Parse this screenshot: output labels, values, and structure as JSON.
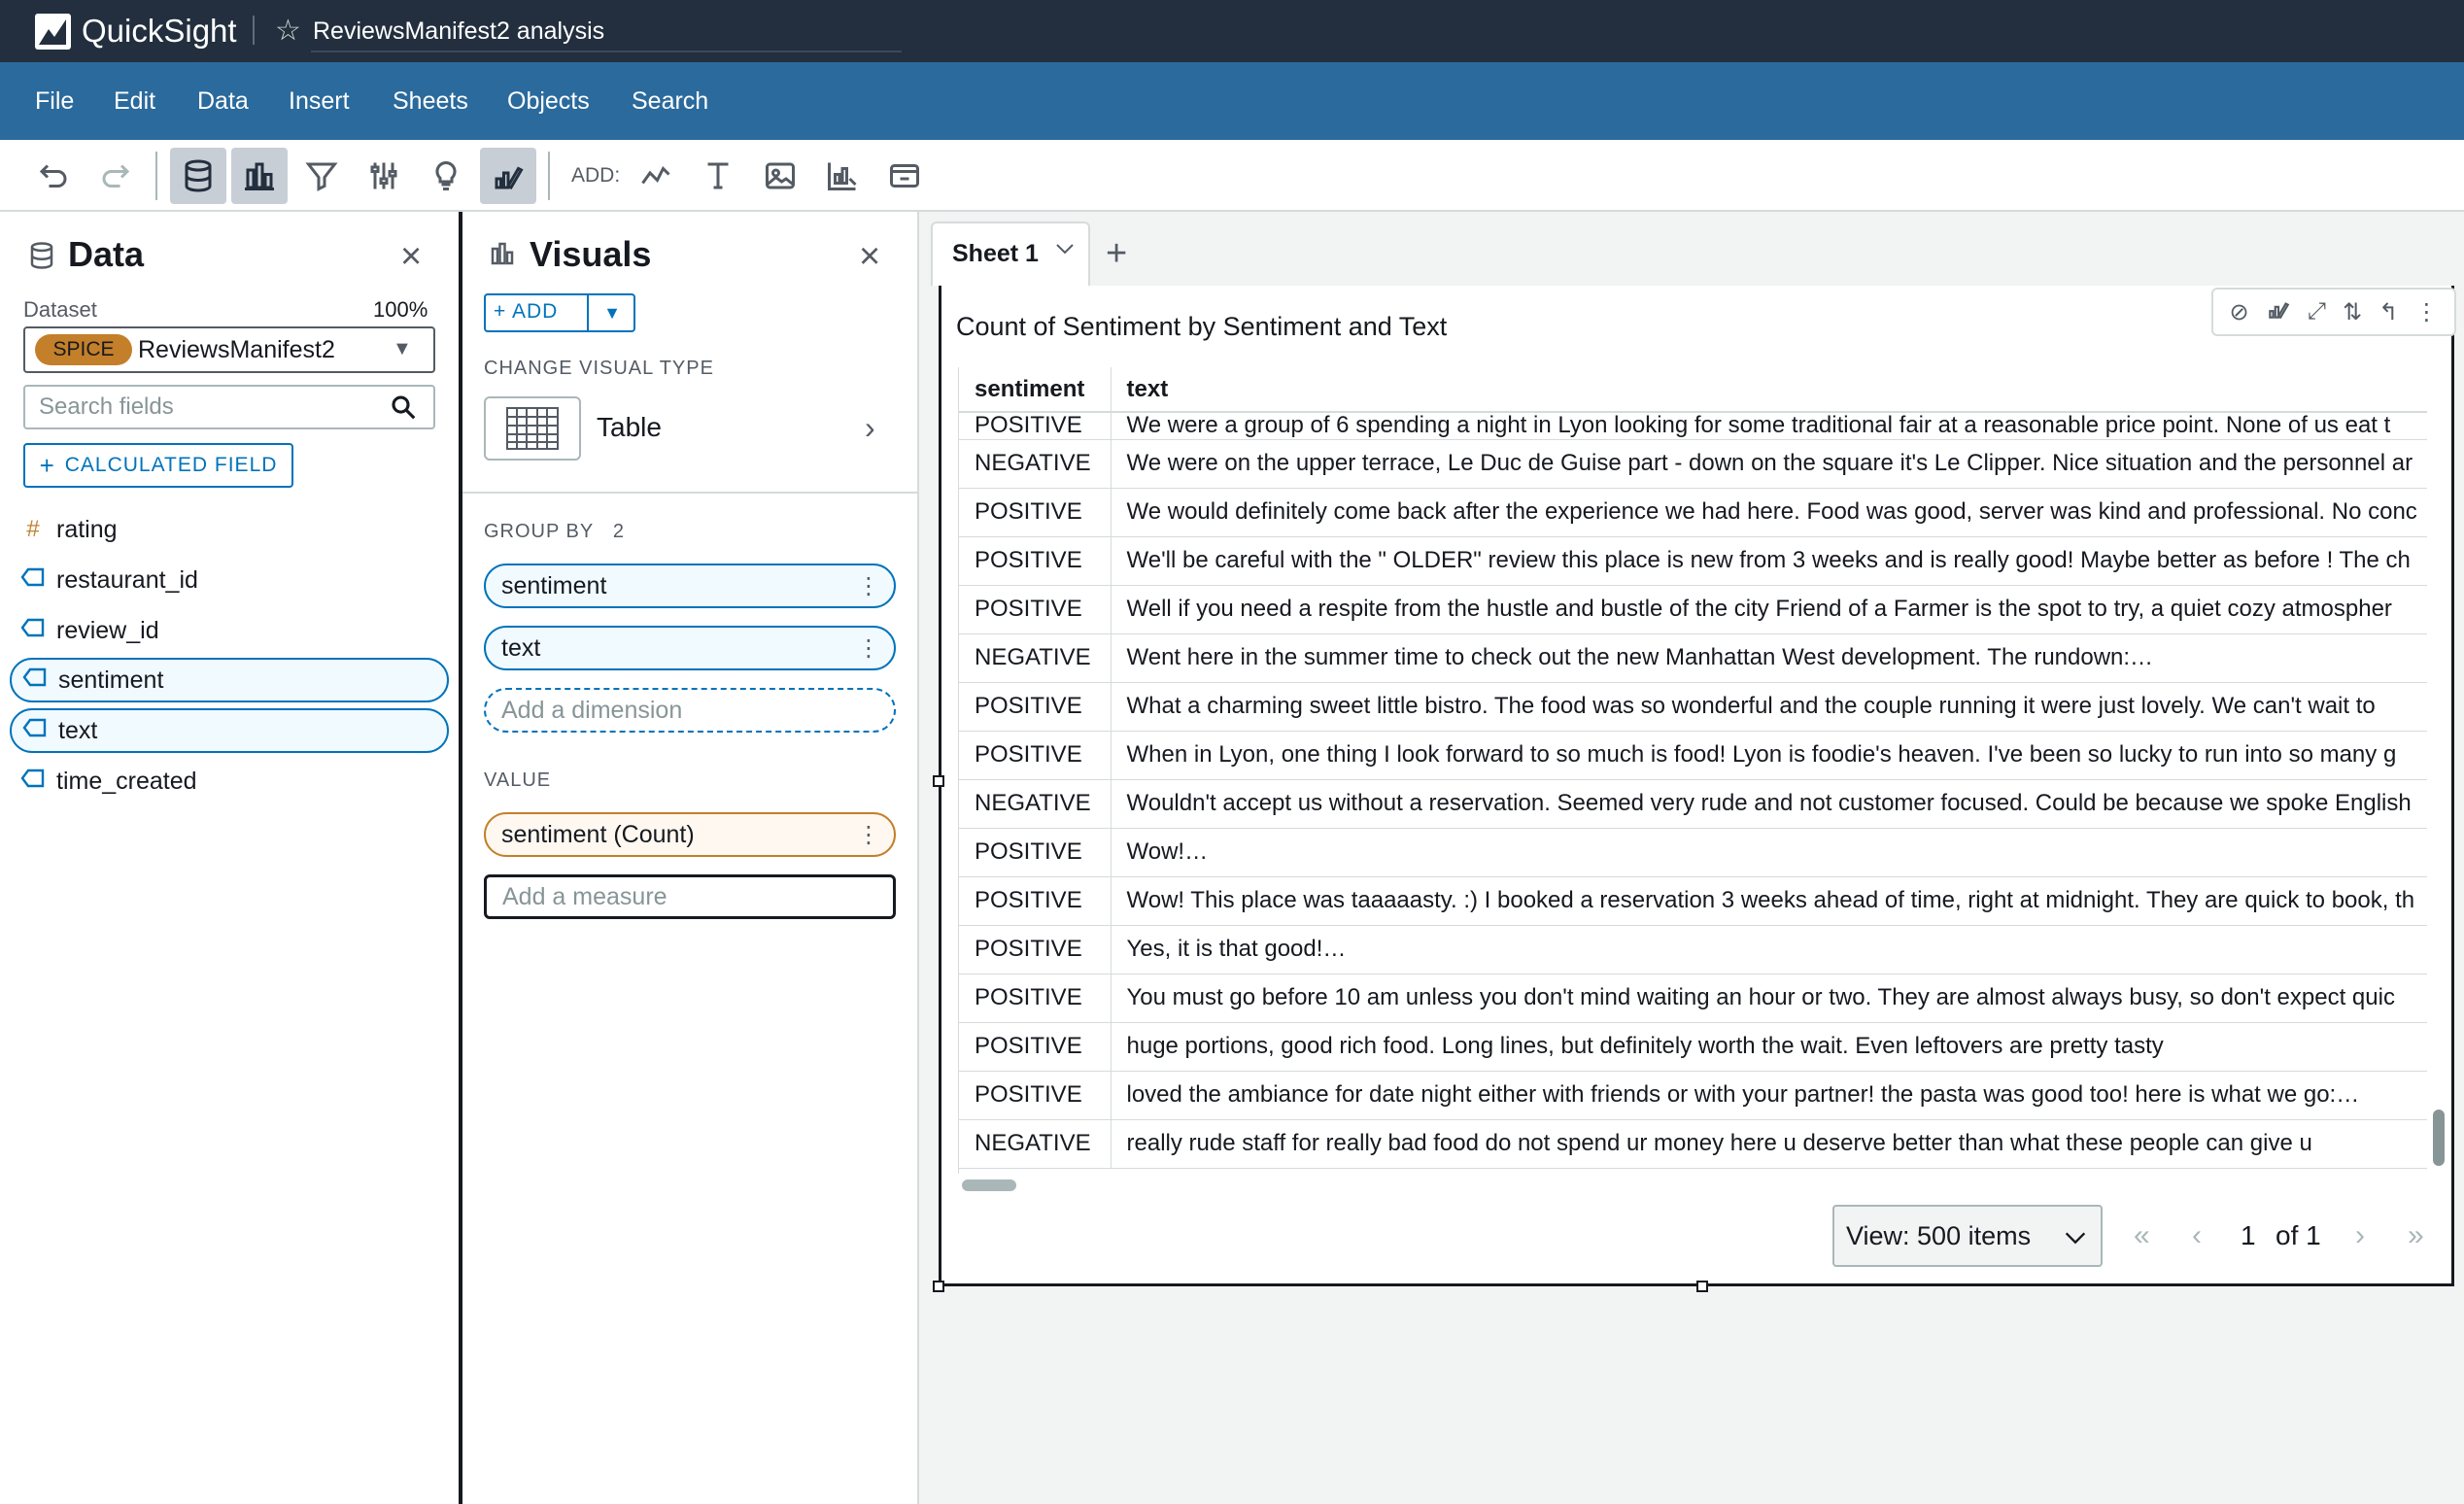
{
  "app": {
    "name": "QuickSight",
    "analysis_title": "ReviewsManifest2 analysis"
  },
  "menu": [
    "File",
    "Edit",
    "Data",
    "Insert",
    "Sheets",
    "Objects",
    "Search"
  ],
  "toolbar": {
    "add_label": "ADD:"
  },
  "data_panel": {
    "title": "Data",
    "dataset_label": "Dataset",
    "dataset_percent": "100%",
    "spice_badge": "SPICE",
    "dataset_name": "ReviewsManifest2",
    "search_placeholder": "Search fields",
    "calculated_field_label": "CALCULATED FIELD",
    "fields": [
      {
        "name": "rating",
        "icon": "#"
      },
      {
        "name": "restaurant_id",
        "icon": "tag"
      },
      {
        "name": "review_id",
        "icon": "tag"
      },
      {
        "name": "sentiment",
        "icon": "tag"
      },
      {
        "name": "text",
        "icon": "tag"
      },
      {
        "name": "time_created",
        "icon": "tag"
      }
    ]
  },
  "visuals_panel": {
    "title": "Visuals",
    "add_label": "ADD",
    "change_type_label": "CHANGE VISUAL TYPE",
    "visual_type": "Table",
    "group_by_label": "GROUP BY",
    "group_by_count": "2",
    "group_by": [
      "sentiment",
      "text"
    ],
    "add_dimension": "Add a dimension",
    "value_label": "VALUE",
    "values": [
      "sentiment (Count)"
    ],
    "add_measure": "Add a measure"
  },
  "sheet": {
    "tab_label": "Sheet 1"
  },
  "visual": {
    "title": "Count of Sentiment by Sentiment and Text",
    "columns": [
      "sentiment",
      "text"
    ],
    "rows": [
      [
        "POSITIVE",
        "We were a group of 6 spending a night in Lyon looking for some traditional fair at a reasonable price point. None of us eat t"
      ],
      [
        "NEGATIVE",
        "We were on the upper terrace, Le Duc de Guise part - down on the square it's Le Clipper. Nice situation and the personnel ar"
      ],
      [
        "POSITIVE",
        "We would definitely come back after the experience we had here. Food was good, server was kind and professional. No conc"
      ],
      [
        "POSITIVE",
        "We'll be careful with the \" OLDER\" review this place is new from 3 weeks and is really good! Maybe better as before ! The ch"
      ],
      [
        "POSITIVE",
        "Well if you need a respite from the hustle and bustle of the city Friend of a Farmer is the spot to try, a quiet cozy atmospher"
      ],
      [
        "NEGATIVE",
        "Went here in the summer time to check out the new Manhattan West development. The rundown:…"
      ],
      [
        "POSITIVE",
        "What a charming sweet little bistro. The food was so wonderful and the couple running it were just lovely. We can't wait to"
      ],
      [
        "POSITIVE",
        "When in Lyon, one thing I look forward to so much is food! Lyon is foodie's heaven. I've been so lucky to run into so many g"
      ],
      [
        "NEGATIVE",
        "Wouldn't accept us without a reservation. Seemed very rude and not customer focused. Could be because we spoke English"
      ],
      [
        "POSITIVE",
        "Wow!…"
      ],
      [
        "POSITIVE",
        "Wow! This place was taaaaasty. :) I booked a reservation 3 weeks ahead of time, right at midnight. They are quick to book, th"
      ],
      [
        "POSITIVE",
        "Yes, it is that good!…"
      ],
      [
        "POSITIVE",
        "You must go before 10 am unless you don't mind waiting an hour or two. They are almost always busy, so don't expect quic"
      ],
      [
        "POSITIVE",
        "huge portions, good rich food. Long lines, but definitely worth the wait. Even leftovers are pretty tasty"
      ],
      [
        "POSITIVE",
        "loved the ambiance for date night either with friends or with your partner! the pasta was good too! here is what we go:…"
      ],
      [
        "NEGATIVE",
        "really rude staff for really bad food do not spend ur money here u deserve better than what these people can give u"
      ]
    ],
    "view_label": "View: 500 items",
    "page_current": "1",
    "page_of": "of 1"
  },
  "colors": {
    "topbar": "#232f3e",
    "menubar": "#2b6a9c",
    "accent": "#0073bb",
    "measure": "#c47f2a"
  }
}
